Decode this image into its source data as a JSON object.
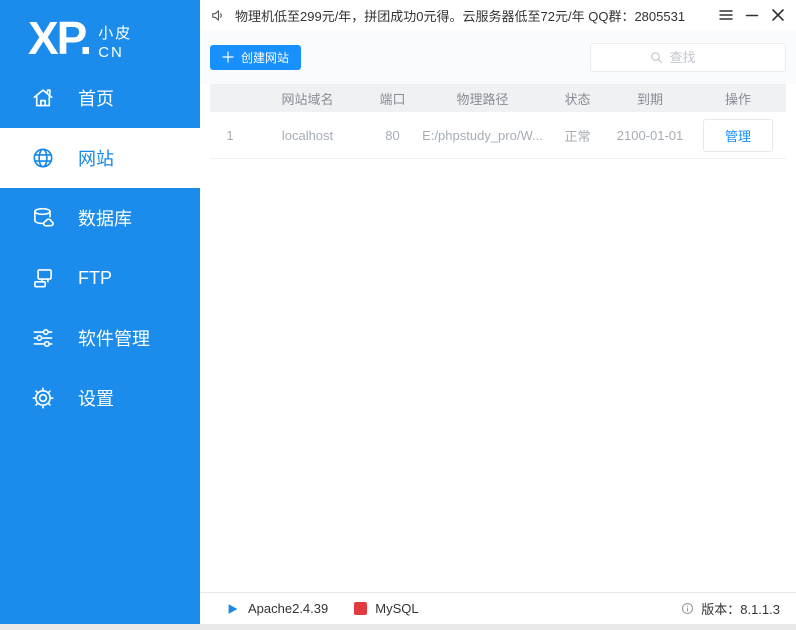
{
  "titlebar": {
    "announcement": "物理机低至299元/年，拼团成功0元得。云服务器低至72元/年  QQ群：2805531"
  },
  "sidebar": {
    "logo_main": "XP.",
    "logo_sub_top": "小皮",
    "logo_sub_bottom": "CN",
    "items": [
      {
        "label": "首页",
        "icon": "home-icon",
        "selected": false
      },
      {
        "label": "网站",
        "icon": "globe-icon",
        "selected": true
      },
      {
        "label": "数据库",
        "icon": "database-icon",
        "selected": false
      },
      {
        "label": "FTP",
        "icon": "ftp-icon",
        "selected": false
      },
      {
        "label": "软件管理",
        "icon": "sliders-icon",
        "selected": false
      },
      {
        "label": "设置",
        "icon": "gear-icon",
        "selected": false
      }
    ]
  },
  "toolbar": {
    "create_site_label": "创建网站",
    "search_placeholder": "查找"
  },
  "table": {
    "headers": {
      "domain": "网站域名",
      "port": "端口",
      "path": "物理路径",
      "status": "状态",
      "expiry": "到期",
      "action": "操作"
    },
    "rows": [
      {
        "index": "1",
        "domain": "localhost",
        "port": "80",
        "path": "E:/phpstudy_pro/W...",
        "status": "正常",
        "expiry": "2100-01-01",
        "action_label": "管理"
      }
    ]
  },
  "statusbar": {
    "apache_label": "Apache2.4.39",
    "mysql_label": "MySQL",
    "version_text": "版本：8.1.1.3"
  },
  "colors": {
    "sidebar_blue": "#1b8ceb",
    "accent_blue": "#1890ff",
    "selected_text_blue": "#1788e8",
    "mysql_red": "#e23b3f",
    "apache_play_blue": "#1e88e5"
  }
}
